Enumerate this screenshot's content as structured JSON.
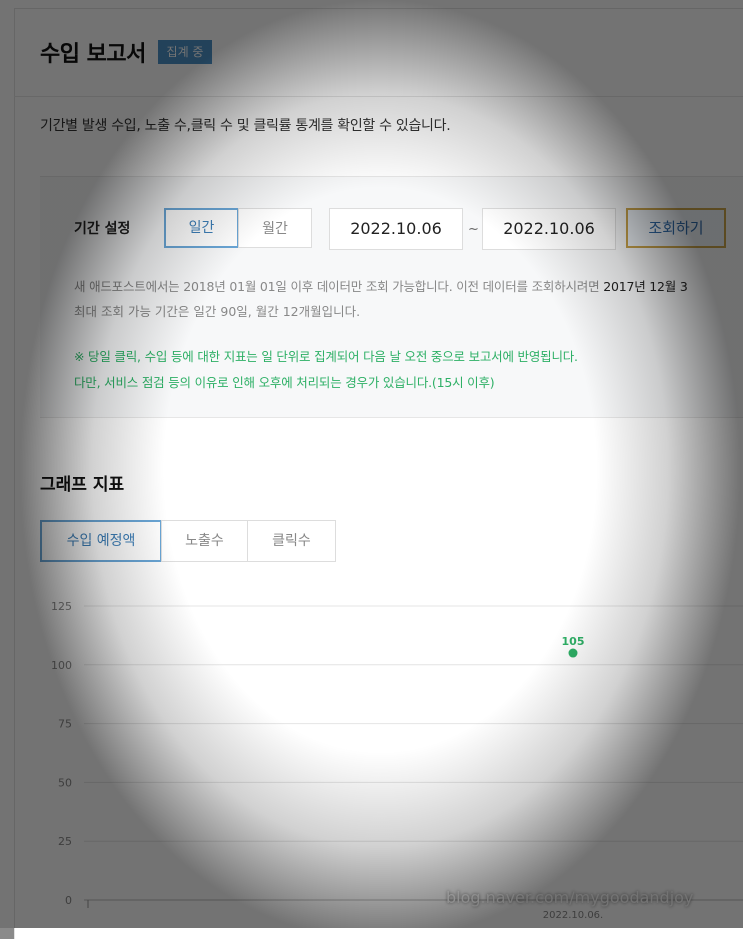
{
  "header": {
    "title": "수입 보고서",
    "badge": "집계 중",
    "description": "기간별 발생 수입, 노출 수,클릭 수 및 클릭률 통계를 확인할 수 있습니다."
  },
  "filter": {
    "label": "기간 설정",
    "period_daily": "일간",
    "period_monthly": "월간",
    "start_date": "2022.10.06",
    "end_date": "2022.10.06",
    "separator": "~",
    "search_button": "조회하기",
    "note1": "새 애드포스트에서는 2018년 01월 01일 이후 데이터만 조회 가능합니다. 이전 데이터를 조회하시려면",
    "note1_bold": "2017년 12월 3",
    "note2": "최대 조회 가능 기간은 일간 90일, 월간 12개월입니다.",
    "green_note1": "※ 당일 클릭, 수입 등에 대한 지표는 일 단위로 집계되어 다음 날 오전 중으로 보고서에 반영됩니다.",
    "green_note2": "다만, 서비스 점검 등의 이유로 인해 오후에 처리되는 경우가 있습니다.(15시 이후)"
  },
  "graph": {
    "title": "그래프 지표",
    "tabs": [
      "수입 예정액",
      "노출수",
      "클릭수"
    ]
  },
  "chart_data": {
    "type": "scatter",
    "x": [
      "2022.10.06."
    ],
    "values": [
      105
    ],
    "data_labels": [
      "105"
    ],
    "y_ticks": [
      "125",
      "100",
      "75",
      "50",
      "25",
      "0"
    ],
    "ylim": [
      0,
      125
    ],
    "grid": true,
    "point_color": "#2eb066"
  },
  "watermark": "blog.naver.com/mygoodandjoy"
}
